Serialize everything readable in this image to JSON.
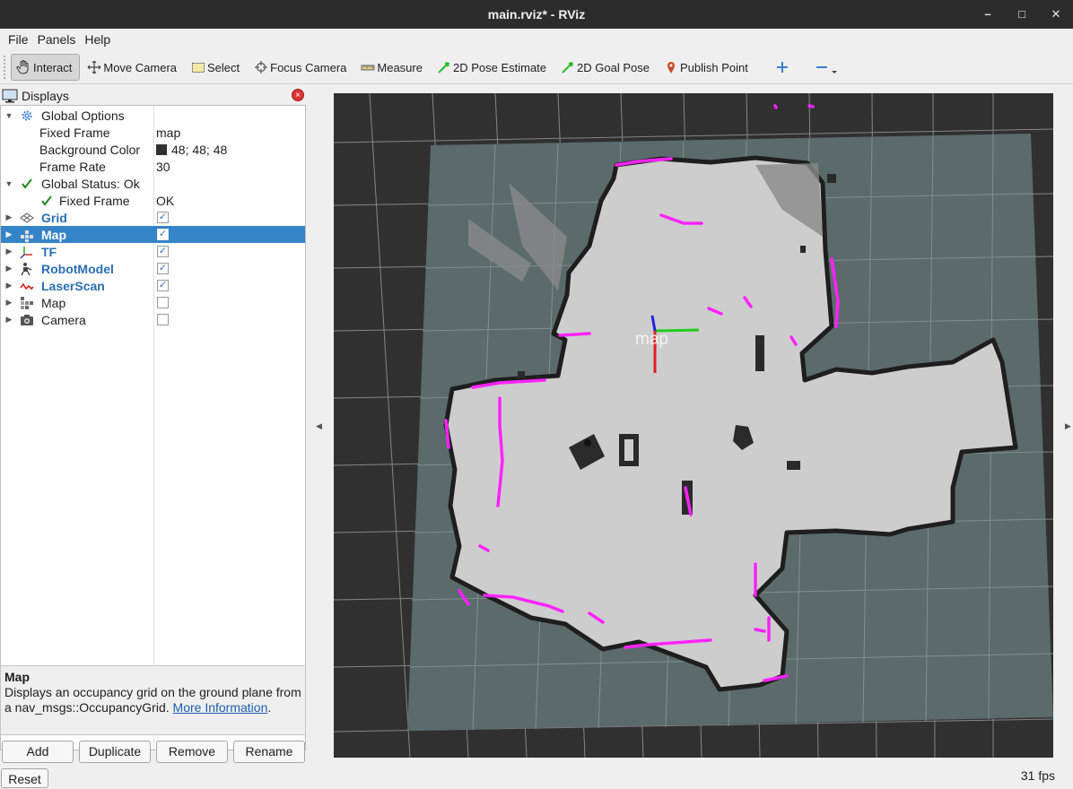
{
  "window": {
    "title": "main.rviz* - RViz",
    "controls": {
      "minimize": "–",
      "maximize": "□",
      "close": "✕"
    }
  },
  "menu": {
    "file": "File",
    "panels": "Panels",
    "help": "Help"
  },
  "toolbar": {
    "interact": "Interact",
    "move_camera": "Move Camera",
    "select": "Select",
    "focus_camera": "Focus Camera",
    "measure": "Measure",
    "pose_estimate": "2D Pose Estimate",
    "goal_pose": "2D Goal Pose",
    "publish_point": "Publish Point"
  },
  "displays_panel": {
    "title": "Displays",
    "rows": {
      "global_options": "Global Options",
      "fixed_frame_label": "Fixed Frame",
      "fixed_frame_value": "map",
      "background_color_label": "Background Color",
      "background_color_value": "48; 48; 48",
      "frame_rate_label": "Frame Rate",
      "frame_rate_value": "30",
      "global_status": "Global Status: Ok",
      "status_fixed_frame_label": "Fixed Frame",
      "status_fixed_frame_value": "OK",
      "grid": "Grid",
      "map": "Map",
      "tf": "TF",
      "robot_model": "RobotModel",
      "laser_scan": "LaserScan",
      "map2": "Map",
      "camera": "Camera"
    },
    "checks": {
      "grid": "✓",
      "map": "✓",
      "tf": "✓",
      "robot_model": "✓",
      "laser_scan": "✓",
      "map2": "",
      "camera": ""
    }
  },
  "description": {
    "title": "Map",
    "text": "Displays an occupancy grid on the ground plane from a nav_msgs::OccupancyGrid. ",
    "link": "More Information",
    "suffix": "."
  },
  "buttons": {
    "add": "Add",
    "duplicate": "Duplicate",
    "remove": "Remove",
    "rename": "Rename"
  },
  "reset": "Reset",
  "fps": "31 fps",
  "viewport": {
    "frame_label": "map"
  },
  "colors": {
    "background": "#303030",
    "map_plane": "#5b6a6a",
    "free_space": "#cdcdcd",
    "laser_scan": "#ff22ff",
    "selection": "#3584c8"
  }
}
